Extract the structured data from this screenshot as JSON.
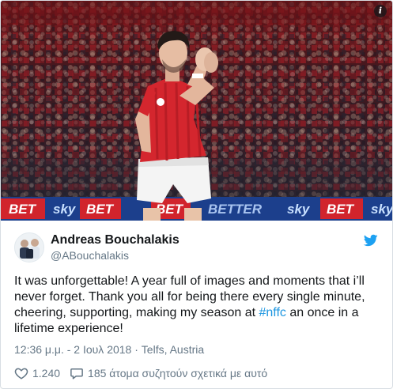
{
  "photo": {
    "alt_icon": "info-icon",
    "info_label": "i",
    "ad_boards": [
      "BET",
      "sky",
      "BET",
      "BET",
      "BETTER",
      "sky",
      "BET",
      "sky"
    ]
  },
  "author": {
    "name": "Andreas Bouchalakis",
    "handle": "@ABouchalakis",
    "avatar_icon": "avatar-photo"
  },
  "brand_icon": "twitter-bird-icon",
  "colors": {
    "brand_blue": "#1da1f2",
    "hashtag_blue": "#1b95e0",
    "text": "#14171a",
    "muted": "#657786",
    "kit_red": "#d4262e"
  },
  "tweet": {
    "text_before": "It was unforgettable! A year full of images and moments that i’ll never forget. Thank you all for being there every single minute, cheering, supporting, making my season at ",
    "hashtag": "#nffc",
    "text_after": " an once in a lifetime experience!"
  },
  "meta": {
    "time": "12:36 μ.μ.",
    "separator1": " - ",
    "date": "2 Ιουλ 2018",
    "separator2": " · ",
    "location": "Telfs, Austria"
  },
  "actions": {
    "likes_icon": "heart-icon",
    "likes_count": "1.240",
    "replies_icon": "speech-bubble-icon",
    "replies_text": "185 άτομα συζητούν σχετικά με αυτό"
  }
}
